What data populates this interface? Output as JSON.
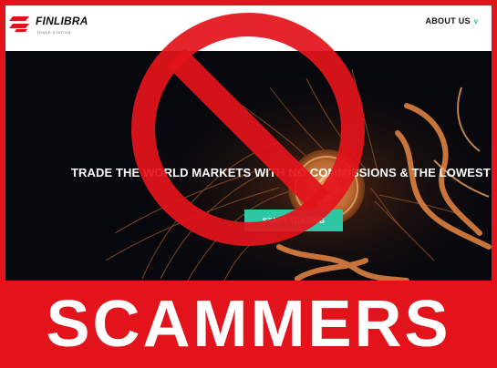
{
  "brand": {
    "name": "FINLIBRA",
    "tagline": "TRADE STATION"
  },
  "nav": {
    "about_label": "ABOUT US",
    "about_chevron": "chevron-down-icon"
  },
  "hero": {
    "headline": "TRADE THE WORLD MARKETS WITH NO COMMISSIONS & THE LOWEST SPREA",
    "cta_label": "START TRADING"
  },
  "overlay": {
    "banner_text": "SCAMMERS",
    "symbol": "prohibition-sign-icon"
  },
  "colors": {
    "warning_red": "#e3131b",
    "accent_green": "#2ec7a6",
    "hero_bg": "#07080d",
    "coin": "#c9743a"
  }
}
